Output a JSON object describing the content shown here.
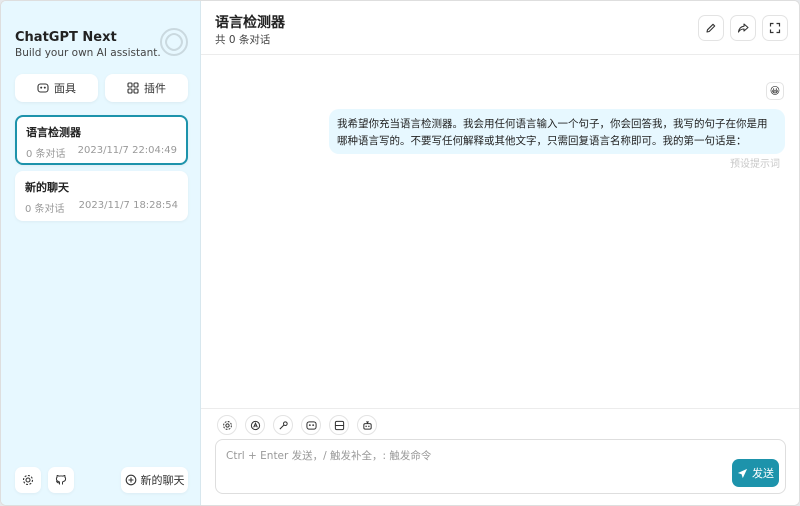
{
  "sidebar": {
    "brand_title": "ChatGPT Next",
    "brand_subtitle": "Build your own AI assistant.",
    "mask_button": "面具",
    "plugin_button": "插件",
    "chats": [
      {
        "title": "语言检测器",
        "count": "0 条对话",
        "date": "2023/11/7 22:04:49",
        "selected": true
      },
      {
        "title": "新的聊天",
        "count": "0 条对话",
        "date": "2023/11/7 18:28:54",
        "selected": false
      }
    ],
    "new_chat_button": "新的聊天"
  },
  "header": {
    "title": "语言检测器",
    "subtitle": "共 0 条对话"
  },
  "messages": [
    {
      "avatar": "😀",
      "text": "我希望你充当语言检测器。我会用任何语言输入一个句子，你会回答我，我写的句子在你是用哪种语言写的。不要写任何解释或其他文字，只需回复语言名称即可。我的第一句话是：",
      "status": "预设提示词"
    }
  ],
  "input": {
    "placeholder": "Ctrl + Enter 发送，/ 触发补全，: 触发命令",
    "send_label": "发送"
  },
  "colors": {
    "accent": "#1d93ab",
    "sidebar_bg": "#e7f8ff",
    "bubble_bg": "#e7f8ff"
  },
  "icons": [
    "robot-logo-icon",
    "mask-icon",
    "plugin-grid-icon",
    "settings-icon",
    "github-icon",
    "add-circle-icon",
    "edit-icon",
    "share-icon",
    "fullscreen-icon",
    "send-icon"
  ]
}
